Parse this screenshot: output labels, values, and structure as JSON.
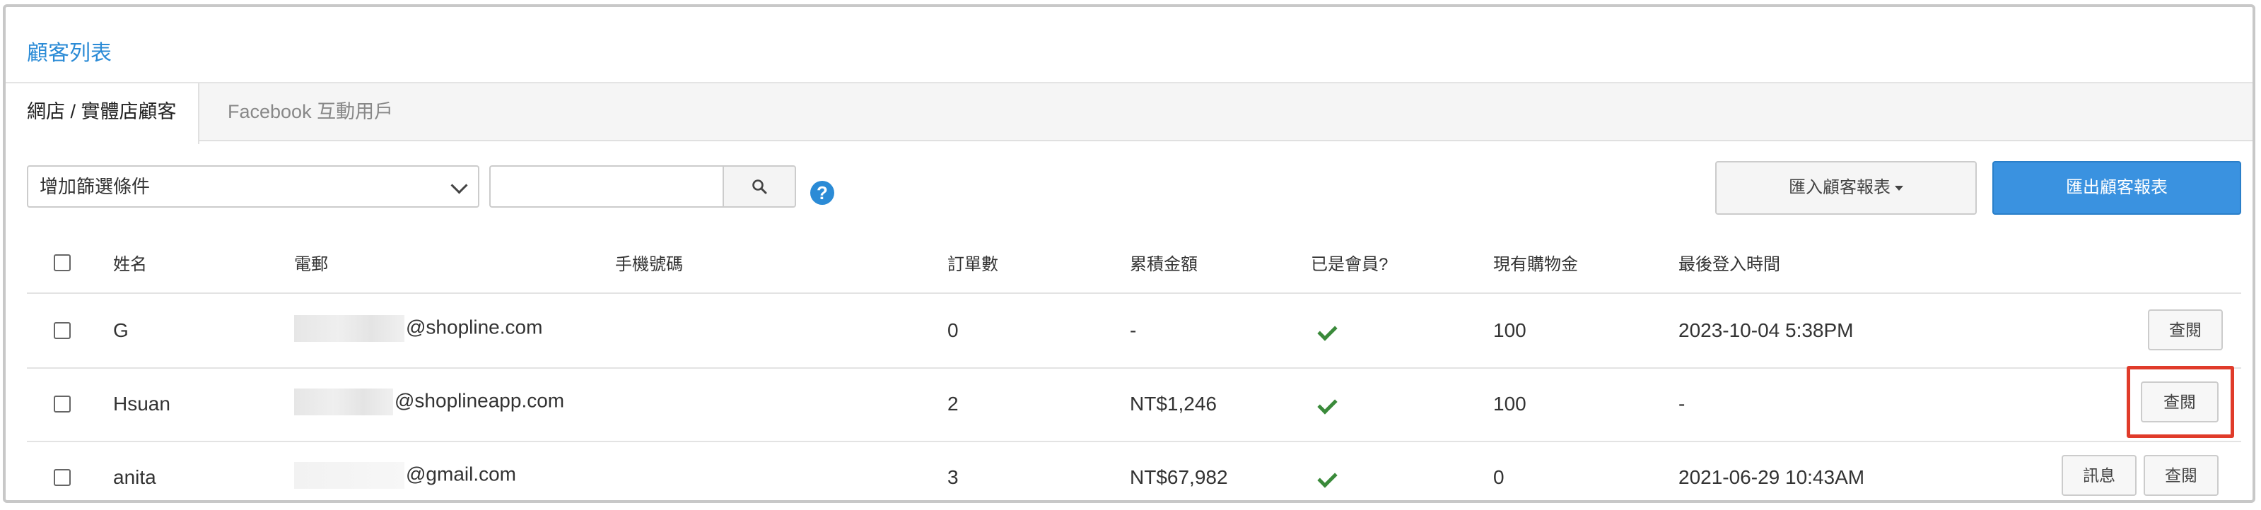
{
  "page": {
    "title": "顧客列表"
  },
  "tabs": [
    {
      "label": "網店 / 實體店顧客",
      "active": true
    },
    {
      "label": "Facebook 互動用戶",
      "active": false
    }
  ],
  "toolbar": {
    "filter_label": "增加篩選條件",
    "search_value": "",
    "search_placeholder": "",
    "help_glyph": "?",
    "import_label": "匯入顧客報表",
    "export_label": "匯出顧客報表"
  },
  "table": {
    "headers": {
      "name": "姓名",
      "email": "電郵",
      "phone": "手機號碼",
      "orders": "訂單數",
      "total": "累積金額",
      "member": "已是會員?",
      "credit": "現有購物金",
      "last_login": "最後登入時間"
    },
    "rows": [
      {
        "name": "G",
        "email_domain": "@shopline.com",
        "phone": "",
        "orders": "0",
        "total": "-",
        "member": true,
        "credit": "100",
        "last_login": "2023-10-04 5:38PM",
        "view_label": "查閱",
        "message_label": ""
      },
      {
        "name": "Hsuan",
        "email_domain": "@shoplineapp.com",
        "phone": "",
        "orders": "2",
        "total": "NT$1,246",
        "member": true,
        "credit": "100",
        "last_login": "-",
        "view_label": "查閱",
        "message_label": ""
      },
      {
        "name": "anita",
        "email_domain": "@gmail.com",
        "phone": "",
        "orders": "3",
        "total": "NT$67,982",
        "member": true,
        "credit": "0",
        "last_login": "2021-06-29 10:43AM",
        "view_label": "查閱",
        "message_label": "訊息"
      }
    ]
  },
  "colors": {
    "accent": "#2b8bd6",
    "export_button": "#3a92e0",
    "check": "#3a8a3a",
    "highlight": "#e03b2a"
  }
}
